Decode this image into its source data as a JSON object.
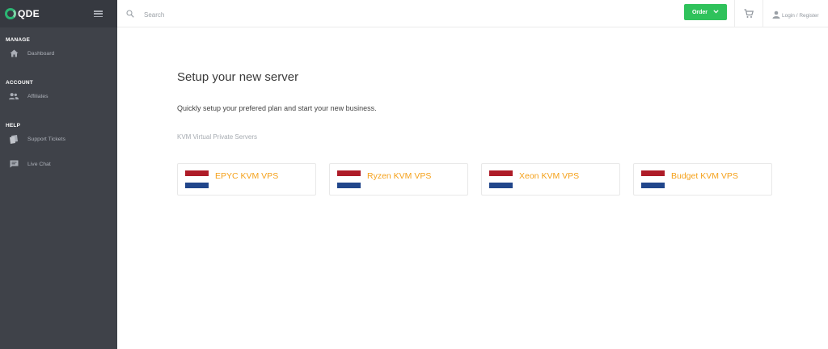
{
  "brand": {
    "name": "QDE",
    "accent": "#2bb673"
  },
  "sidebar": {
    "sections": [
      {
        "title": "MANAGE",
        "items": [
          {
            "label": "Dashboard",
            "icon": "home-icon"
          }
        ]
      },
      {
        "title": "ACCOUNT",
        "items": [
          {
            "label": "Affiliates",
            "icon": "users-icon"
          }
        ]
      },
      {
        "title": "HELP",
        "items": [
          {
            "label": "Support Tickets",
            "icon": "tickets-icon"
          },
          {
            "label": "Live Chat",
            "icon": "chat-icon"
          }
        ]
      }
    ],
    "background": "#3f4249"
  },
  "topbar": {
    "search_placeholder": "Search",
    "order_label": "Order",
    "order_color": "#2fc25b",
    "login_label": "Login / Register"
  },
  "main": {
    "title": "Setup your new server",
    "subtitle": "Quickly setup your prefered plan and start your new business.",
    "category": "KVM Virtual Private Servers",
    "products": [
      {
        "name": "EPYC KVM VPS",
        "flag": "netherlands-flag"
      },
      {
        "name": "Ryzen KVM VPS",
        "flag": "netherlands-flag"
      },
      {
        "name": "Xeon KVM VPS",
        "flag": "netherlands-flag"
      },
      {
        "name": "Budget KVM VPS",
        "flag": "netherlands-flag"
      }
    ],
    "product_color": "#f5a11a",
    "flag_colors": [
      "#ae1c28",
      "#ffffff",
      "#21468b"
    ]
  }
}
